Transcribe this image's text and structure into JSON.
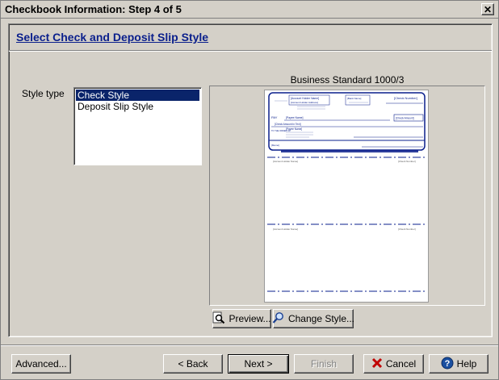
{
  "window": {
    "title": "Checkbook Information: Step 4 of 5",
    "close_glyph": "✕"
  },
  "page": {
    "heading": "Select Check and Deposit Slip Style"
  },
  "style_type": {
    "label": "Style type",
    "options": [
      {
        "label": "Check Style",
        "selected": true
      },
      {
        "label": "Deposit Slip Style",
        "selected": false
      }
    ]
  },
  "preview": {
    "style_name": "Business Standard 1000/3",
    "check": {
      "company_name": "[Account Holder Name]",
      "company_addr": "[Account Holder Address]",
      "bank_name": "[Bank Name]",
      "check_number": "[Check Number]",
      "pay_label": "PAY",
      "payee": "[Payee Name]",
      "amount_words": "[Check Amount in Text]",
      "amount_box": "[Check Amount]",
      "order_label": "TO THE ORDER OF",
      "payee_block": "[Payee Name]",
      "memo": "[Memo]",
      "stub_left": "[Account Holder Name]",
      "stub_right": "[Check Number]"
    },
    "buttons": {
      "preview_label": "Preview...",
      "change_style_label": "Change Style..."
    }
  },
  "footer": {
    "advanced_label": "Advanced...",
    "back_label": "< Back",
    "next_label": "Next >",
    "finish_label": "Finish",
    "cancel_label": "Cancel",
    "help_label": "Help"
  },
  "colors": {
    "accent": "#0a1f8c",
    "selection": "#0a246a",
    "cancel_icon": "#c00000",
    "help_icon": "#1a4fa0"
  }
}
